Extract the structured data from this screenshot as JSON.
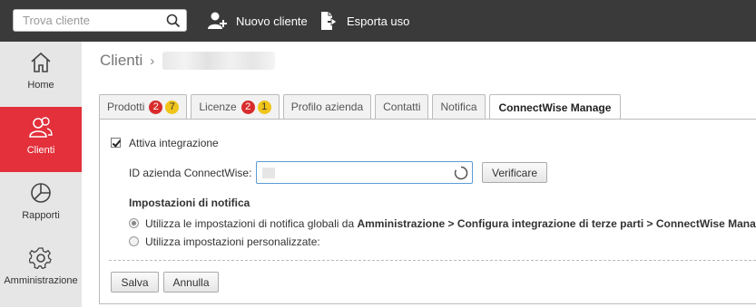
{
  "topbar": {
    "search_placeholder": "Trova cliente",
    "new_client_label": "Nuovo cliente",
    "export_label": "Esporta uso"
  },
  "sidebar": {
    "items": [
      {
        "label": "Home",
        "icon": "home-icon"
      },
      {
        "label": "Clienti",
        "icon": "users-icon",
        "active": true
      },
      {
        "label": "Rapporti",
        "icon": "pie-chart-icon"
      },
      {
        "label": "Amministrazione",
        "icon": "gear-icon"
      }
    ]
  },
  "breadcrumb": {
    "root": "Clienti",
    "separator": "›"
  },
  "tabs": [
    {
      "label": "Prodotti",
      "badge_red": "2",
      "badge_yellow": "7"
    },
    {
      "label": "Licenze",
      "badge_red": "2",
      "badge_yellow": "1"
    },
    {
      "label": "Profilo azienda"
    },
    {
      "label": "Contatti"
    },
    {
      "label": "Notifica"
    },
    {
      "label": "ConnectWise Manage",
      "active": true
    }
  ],
  "form": {
    "enable_integration_label": "Attiva integrazione",
    "enable_integration_checked": true,
    "company_id_label": "ID azienda ConnectWise:",
    "verify_button": "Verificare",
    "notification_heading": "Impostazioni di notifica",
    "radio_global_prefix": "Utilizza le impostazioni di notifica globali da ",
    "radio_global_path": "Amministrazione > Configura integrazione di terze parti > ConnectWise Manage",
    "radio_global_suffix": ".",
    "radio_custom_label": "Utilizza impostazioni personalizzate:",
    "selected_radio": "global",
    "save_button": "Salva",
    "cancel_button": "Annulla"
  },
  "colors": {
    "topbar": "#3a3a3a",
    "sidebar": "#e6e6e6",
    "accent": "#e3303b",
    "badge_red": "#d92b2b",
    "badge_yellow": "#f0c419",
    "focus_border": "#5b9bd5"
  }
}
